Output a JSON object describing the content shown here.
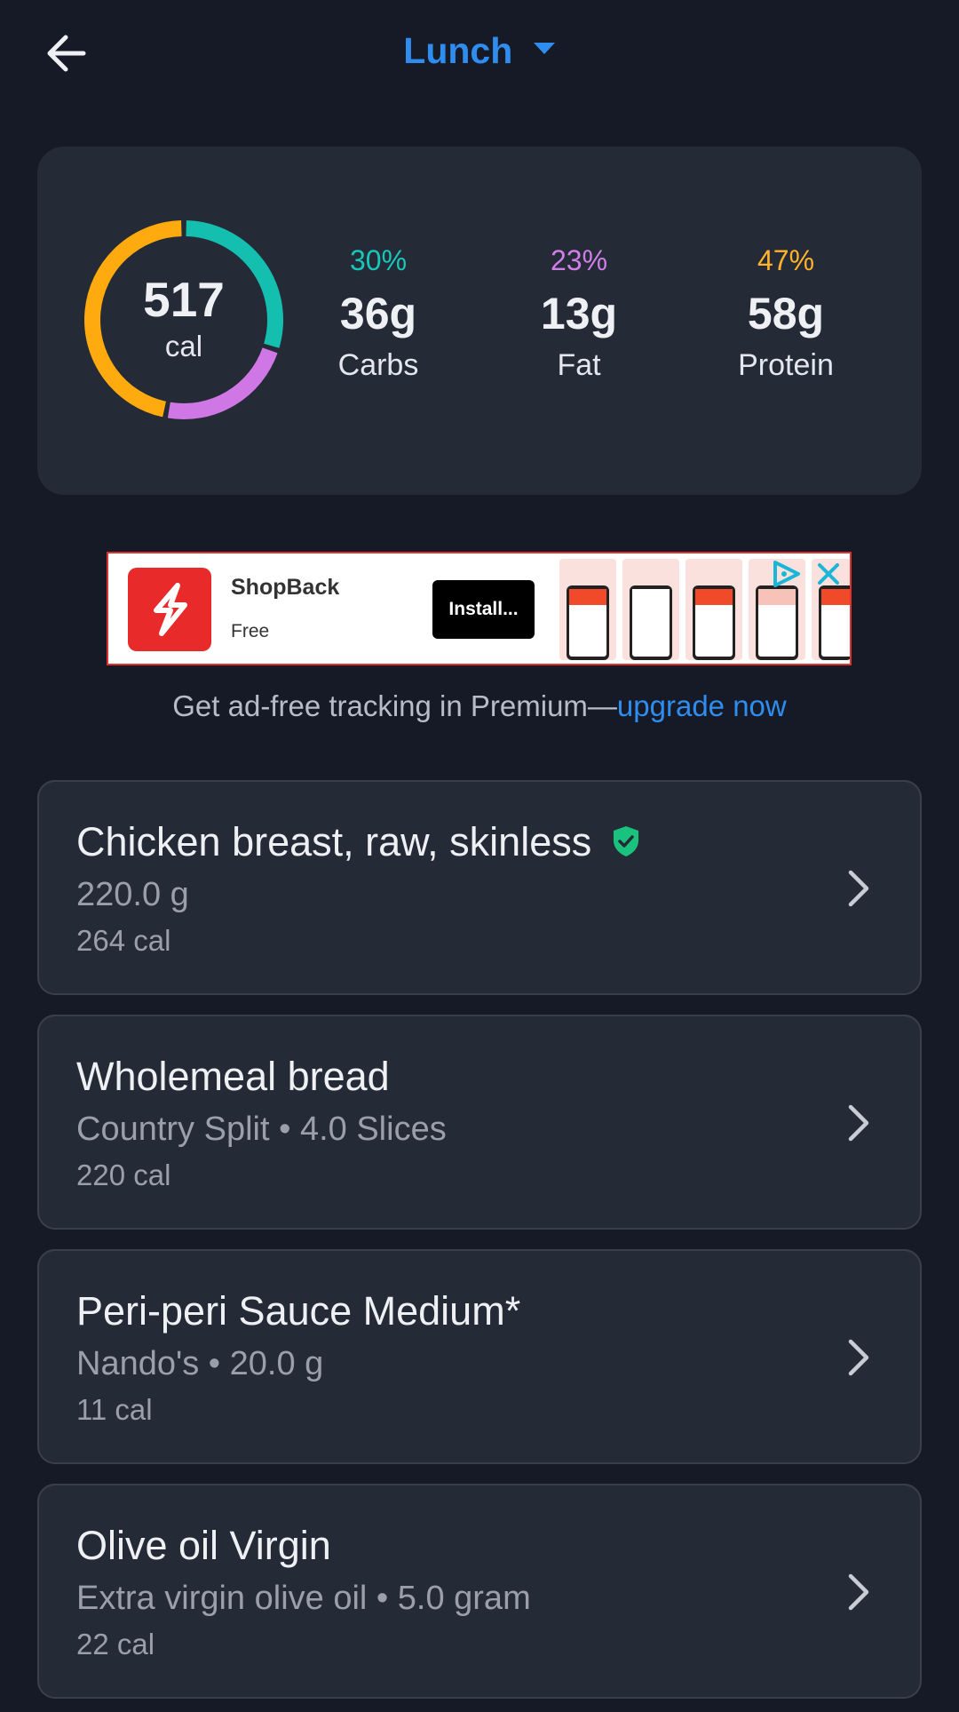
{
  "header": {
    "title": "Lunch"
  },
  "summary": {
    "calories": "517",
    "calories_unit": "cal",
    "ring": [
      {
        "name": "Carbs",
        "fraction": 0.3,
        "color": "#14bfb0"
      },
      {
        "name": "Fat",
        "fraction": 0.23,
        "color": "#d077e6"
      },
      {
        "name": "Protein",
        "fraction": 0.47,
        "color": "#ffab10"
      }
    ],
    "macros": [
      {
        "percent": "30%",
        "grams": "36g",
        "label": "Carbs",
        "color": "#18c7b8"
      },
      {
        "percent": "23%",
        "grams": "13g",
        "label": "Fat",
        "color": "#cf7fe8"
      },
      {
        "percent": "47%",
        "grams": "58g",
        "label": "Protein",
        "color": "#ffb32a"
      }
    ]
  },
  "ad": {
    "app_name": "ShopBack",
    "price": "Free",
    "install_label": "Install..."
  },
  "premium": {
    "text": "Get ad-free tracking in Premium—",
    "link": "upgrade now"
  },
  "foods": [
    {
      "name": "Chicken breast, raw, skinless",
      "detail": "220.0 g",
      "calories": "264 cal",
      "verified": true
    },
    {
      "name": "Wholemeal bread",
      "detail": "Country Split • 4.0 Slices",
      "calories": "220 cal",
      "verified": false
    },
    {
      "name": "Peri-peri Sauce Medium*",
      "detail": "Nando's • 20.0 g",
      "calories": "11 cal",
      "verified": false
    },
    {
      "name": "Olive oil Virgin",
      "detail": "Extra virgin olive oil • 5.0 gram",
      "calories": "22 cal",
      "verified": false
    }
  ],
  "colors": {
    "accent": "#2f8df0",
    "verified": "#19c37d"
  }
}
